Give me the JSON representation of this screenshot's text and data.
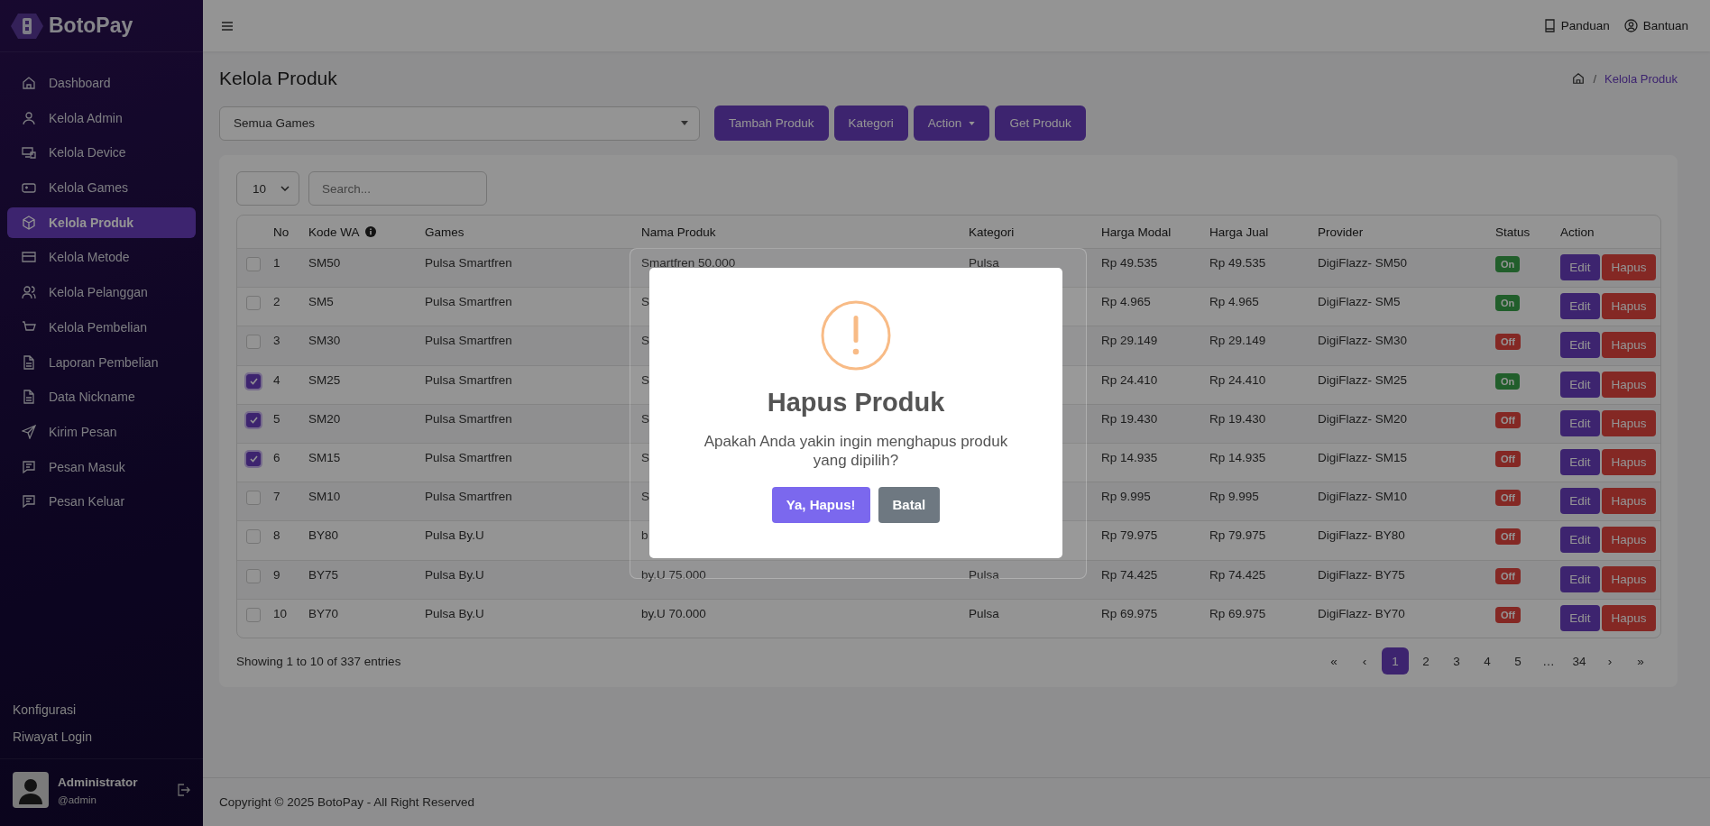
{
  "brand": {
    "name": "BotoPay"
  },
  "sidebar": {
    "items": [
      {
        "label": "Dashboard",
        "selected": false
      },
      {
        "label": "Kelola Admin",
        "selected": false
      },
      {
        "label": "Kelola Device",
        "selected": false
      },
      {
        "label": "Kelola Games",
        "selected": false
      },
      {
        "label": "Kelola Produk",
        "selected": true
      },
      {
        "label": "Kelola Metode",
        "selected": false
      },
      {
        "label": "Kelola Pelanggan",
        "selected": false
      },
      {
        "label": "Kelola Pembelian",
        "selected": false
      },
      {
        "label": "Laporan Pembelian",
        "selected": false
      },
      {
        "label": "Data Nickname",
        "selected": false
      },
      {
        "label": "Kirim Pesan",
        "selected": false
      },
      {
        "label": "Pesan Masuk",
        "selected": false
      },
      {
        "label": "Pesan Keluar",
        "selected": false
      }
    ],
    "bottom_links": [
      "Konfigurasi",
      "Riwayat Login"
    ],
    "user": {
      "name": "Administrator",
      "handle": "@admin"
    }
  },
  "topbar": {
    "links": [
      "Panduan",
      "Bantuan"
    ]
  },
  "page": {
    "title": "Kelola Produk",
    "breadcrumb": [
      "/",
      "Kelola Produk"
    ]
  },
  "toolbar": {
    "game_select": "Semua Games",
    "buttons": [
      {
        "label": "Tambah Produk",
        "dropdown": false
      },
      {
        "label": "Kategori",
        "dropdown": false
      },
      {
        "label": "Action",
        "dropdown": true
      },
      {
        "label": "Get Produk",
        "dropdown": false
      }
    ]
  },
  "table": {
    "page_length": "10",
    "search": {
      "placeholder": "Search..."
    },
    "columns": [
      "No",
      "Kode WA",
      "Games",
      "Nama Produk",
      "Kategori",
      "Harga Modal",
      "Harga Jual",
      "Provider",
      "Status",
      "Action"
    ],
    "rows": [
      {
        "checked": false,
        "no": "1",
        "kode": "SM50",
        "games": "Pulsa Smartfren",
        "nama": "Smartfren 50.000",
        "kategori": "Pulsa",
        "modal": "Rp 49.535",
        "jual": "Rp 49.535",
        "provider": "DigiFlazz- SM50",
        "status": "On",
        "on": true,
        "edit": "Edit",
        "hapus": "Hapus"
      },
      {
        "checked": false,
        "no": "2",
        "kode": "SM5",
        "games": "Pulsa Smartfren",
        "nama": "S",
        "modal": "Rp 4.965",
        "jual": "Rp 4.965",
        "provider": "DigiFlazz- SM5",
        "status": "On",
        "on": true,
        "edit": "Edit",
        "hapus": "Hapus"
      },
      {
        "checked": false,
        "no": "3",
        "kode": "SM30",
        "games": "Pulsa Smartfren",
        "nama": "S",
        "modal": "Rp 29.149",
        "jual": "Rp 29.149",
        "provider": "DigiFlazz- SM30",
        "status": "Off",
        "on": false,
        "edit": "Edit",
        "hapus": "Hapus"
      },
      {
        "checked": true,
        "no": "4",
        "kode": "SM25",
        "games": "Pulsa Smartfren",
        "nama": "S",
        "modal": "Rp 24.410",
        "jual": "Rp 24.410",
        "provider": "DigiFlazz- SM25",
        "status": "On",
        "on": true,
        "edit": "Edit",
        "hapus": "Hapus"
      },
      {
        "checked": true,
        "no": "5",
        "kode": "SM20",
        "games": "Pulsa Smartfren",
        "nama": "S",
        "modal": "Rp 19.430",
        "jual": "Rp 19.430",
        "provider": "DigiFlazz- SM20",
        "status": "Off",
        "on": false,
        "edit": "Edit",
        "hapus": "Hapus"
      },
      {
        "checked": true,
        "no": "6",
        "kode": "SM15",
        "games": "Pulsa Smartfren",
        "nama": "S",
        "modal": "Rp 14.935",
        "jual": "Rp 14.935",
        "provider": "DigiFlazz- SM15",
        "status": "Off",
        "on": false,
        "edit": "Edit",
        "hapus": "Hapus"
      },
      {
        "checked": false,
        "no": "7",
        "kode": "SM10",
        "games": "Pulsa Smartfren",
        "nama": "S",
        "modal": "Rp 9.995",
        "jual": "Rp 9.995",
        "provider": "DigiFlazz- SM10",
        "status": "Off",
        "on": false,
        "edit": "Edit",
        "hapus": "Hapus"
      },
      {
        "checked": false,
        "no": "8",
        "kode": "BY80",
        "games": "Pulsa By.U",
        "nama": "b",
        "modal": "Rp 79.975",
        "jual": "Rp 79.975",
        "provider": "DigiFlazz- BY80",
        "status": "Off",
        "on": false,
        "edit": "Edit",
        "hapus": "Hapus"
      },
      {
        "checked": false,
        "no": "9",
        "kode": "BY75",
        "games": "Pulsa By.U",
        "nama": "by.U 75.000",
        "kategori": "Pulsa",
        "modal": "Rp 74.425",
        "jual": "Rp 74.425",
        "provider": "DigiFlazz- BY75",
        "status": "Off",
        "on": false,
        "edit": "Edit",
        "hapus": "Hapus"
      },
      {
        "checked": false,
        "no": "10",
        "kode": "BY70",
        "games": "Pulsa By.U",
        "nama": "by.U 70.000",
        "kategori": "Pulsa",
        "modal": "Rp 69.975",
        "jual": "Rp 69.975",
        "provider": "DigiFlazz- BY70",
        "status": "Off",
        "on": false,
        "edit": "Edit",
        "hapus": "Hapus"
      }
    ],
    "info": "Showing 1 to 10 of 337 entries",
    "pagination": [
      {
        "label": "«",
        "selected": false
      },
      {
        "label": "‹",
        "selected": false
      },
      {
        "label": "1",
        "selected": true
      },
      {
        "label": "2",
        "selected": false
      },
      {
        "label": "3",
        "selected": false
      },
      {
        "label": "4",
        "selected": false
      },
      {
        "label": "5",
        "selected": false
      },
      {
        "label": "…",
        "selected": false
      },
      {
        "label": "34",
        "selected": false
      },
      {
        "label": "›",
        "selected": false
      },
      {
        "label": "»",
        "selected": false
      }
    ]
  },
  "footer": "Copyright © 2025 BotoPay - All Right Reserved",
  "dialog": {
    "title": "Hapus Produk",
    "message": "Apakah Anda yakin ingin menghapus produk yang dipilih?",
    "confirm": "Ya, Hapus!",
    "cancel": "Batal"
  }
}
